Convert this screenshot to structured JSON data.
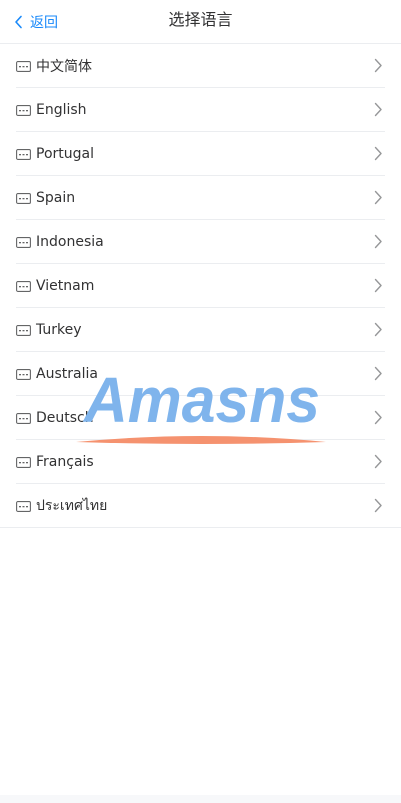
{
  "header": {
    "back_label": "返回",
    "title": "选择语言"
  },
  "languages": [
    {
      "label": "中文简体",
      "icon": "keyboard-icon"
    },
    {
      "label": "English",
      "icon": "keyboard-icon"
    },
    {
      "label": "Portugal",
      "icon": "keyboard-icon"
    },
    {
      "label": "Spain",
      "icon": "keyboard-icon"
    },
    {
      "label": "Indonesia",
      "icon": "keyboard-icon"
    },
    {
      "label": "Vietnam",
      "icon": "keyboard-icon"
    },
    {
      "label": "Turkey",
      "icon": "keyboard-icon"
    },
    {
      "label": "Australia",
      "icon": "keyboard-icon"
    },
    {
      "label": "Deutsch",
      "icon": "keyboard-icon"
    },
    {
      "label": "Français",
      "icon": "keyboard-icon"
    },
    {
      "label": "ประเทศไทย",
      "icon": "keyboard-icon"
    }
  ],
  "watermark": {
    "text": "Amasns",
    "text_color": "#7fb4ec",
    "swoosh_color": "#f5926f"
  },
  "colors": {
    "accent": "#1989fa",
    "text": "#323233",
    "divider": "#ebedf0",
    "icon": "#646566",
    "chevron": "#969799"
  }
}
